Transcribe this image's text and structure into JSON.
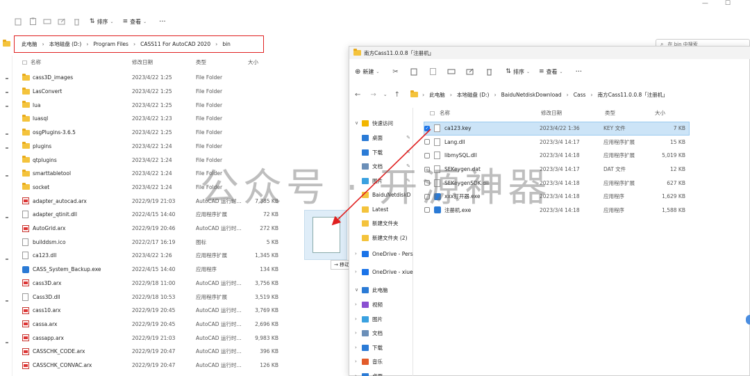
{
  "window_controls": [
    "—",
    "☐",
    "✕"
  ],
  "back": {
    "toolbar": {
      "sort": "排序",
      "view": "查看",
      "more": "···"
    },
    "breadcrumb": [
      "此电脑",
      "本地磁盘 (D:)",
      "Program Files",
      "CASS11 For AutoCAD 2020",
      "bin"
    ],
    "search_placeholder": "在 bin 中搜索",
    "headers": {
      "name": "名称",
      "date": "修改日期",
      "type": "类型",
      "size": "大小"
    },
    "rows": [
      {
        "name": "cass3D_images",
        "date": "2023/4/22 1:25",
        "type": "File Folder",
        "size": "",
        "icon": "folder"
      },
      {
        "name": "LasConvert",
        "date": "2023/4/22 1:25",
        "type": "File Folder",
        "size": "",
        "icon": "folder"
      },
      {
        "name": "lua",
        "date": "2023/4/22 1:25",
        "type": "File Folder",
        "size": "",
        "icon": "folder"
      },
      {
        "name": "luasql",
        "date": "2023/4/22 1:23",
        "type": "File Folder",
        "size": "",
        "icon": "folder"
      },
      {
        "name": "osgPlugins-3.6.5",
        "date": "2023/4/22 1:25",
        "type": "File Folder",
        "size": "",
        "icon": "folder"
      },
      {
        "name": "plugins",
        "date": "2023/4/22 1:24",
        "type": "File Folder",
        "size": "",
        "icon": "folder"
      },
      {
        "name": "qtplugins",
        "date": "2023/4/22 1:24",
        "type": "File Folder",
        "size": "",
        "icon": "folder"
      },
      {
        "name": "smarttabletool",
        "date": "2023/4/22 1:24",
        "type": "File Folder",
        "size": "",
        "icon": "folder"
      },
      {
        "name": "socket",
        "date": "2023/4/22 1:24",
        "type": "File Folder",
        "size": "",
        "icon": "folder"
      },
      {
        "name": "adapter_autocad.arx",
        "date": "2022/9/19 21:03",
        "type": "AutoCAD 运行时...",
        "size": "7,385 KB",
        "icon": "arx"
      },
      {
        "name": "adapter_qtinit.dll",
        "date": "2022/4/15 14:40",
        "type": "应用程序扩展",
        "size": "72 KB",
        "icon": "file"
      },
      {
        "name": "AutoGrid.arx",
        "date": "2022/9/19 20:46",
        "type": "AutoCAD 运行时...",
        "size": "272 KB",
        "icon": "arx"
      },
      {
        "name": "builddsm.ico",
        "date": "2022/2/17 16:19",
        "type": "图标",
        "size": "5 KB",
        "icon": "ico"
      },
      {
        "name": "ca123.dll",
        "date": "2023/4/22 1:26",
        "type": "应用程序扩展",
        "size": "1,345 KB",
        "icon": "file"
      },
      {
        "name": "CASS_System_Backup.exe",
        "date": "2022/4/15 14:40",
        "type": "应用程序",
        "size": "134 KB",
        "icon": "exe"
      },
      {
        "name": "cass3D.arx",
        "date": "2022/9/18 11:00",
        "type": "AutoCAD 运行时...",
        "size": "3,756 KB",
        "icon": "arx"
      },
      {
        "name": "Cass3D.dll",
        "date": "2022/9/18 10:53",
        "type": "应用程序扩展",
        "size": "3,519 KB",
        "icon": "file"
      },
      {
        "name": "cass10.arx",
        "date": "2022/9/19 20:45",
        "type": "AutoCAD 运行时...",
        "size": "3,769 KB",
        "icon": "arx"
      },
      {
        "name": "cassa.arx",
        "date": "2022/9/19 20:45",
        "type": "AutoCAD 运行时...",
        "size": "2,696 KB",
        "icon": "arx"
      },
      {
        "name": "cassapp.arx",
        "date": "2022/9/19 21:03",
        "type": "AutoCAD 运行时...",
        "size": "9,983 KB",
        "icon": "arx"
      },
      {
        "name": "CASSCHK_CODE.arx",
        "date": "2022/9/19 20:47",
        "type": "AutoCAD 运行时...",
        "size": "396 KB",
        "icon": "arx"
      },
      {
        "name": "CASSCHK_CONVAC.arx",
        "date": "2022/9/19 20:47",
        "type": "AutoCAD 运行时...",
        "size": "126 KB",
        "icon": "arx"
      }
    ]
  },
  "front": {
    "title": "南方Cass11.0.0.8「注册机」",
    "toolbar": {
      "new": "新建",
      "sort": "排序",
      "view": "查看",
      "more": "···"
    },
    "breadcrumb": [
      "此电脑",
      "本地磁盘 (D:)",
      "BaiduNetdiskDownload",
      "Cass",
      "南方Cass11.0.0.8「注册机」"
    ],
    "headers": {
      "name": "名称",
      "date": "修改日期",
      "type": "类型",
      "size": "大小"
    },
    "nav": [
      {
        "label": "快速访问",
        "chev": "∨",
        "color": "#f2b600",
        "pin": false
      },
      {
        "label": "桌面",
        "chev": "",
        "color": "#2b7bd6",
        "pin": true
      },
      {
        "label": "下载",
        "chev": "",
        "color": "#2b7bd6",
        "pin": true
      },
      {
        "label": "文档",
        "chev": "",
        "color": "#6b8fb8",
        "pin": true
      },
      {
        "label": "图片",
        "chev": "",
        "color": "#3aa1e0",
        "pin": true
      },
      {
        "label": "BaiduNetdiskD",
        "chev": "",
        "color": "#f4c33c",
        "pin": false
      },
      {
        "label": "Latest",
        "chev": "",
        "color": "#f4c33c",
        "pin": false
      },
      {
        "label": "新建文件夹",
        "chev": "",
        "color": "#f4c33c",
        "pin": false
      },
      {
        "label": "新建文件夹 (2)",
        "chev": "",
        "color": "#f4c33c",
        "pin": false
      },
      {
        "label": "OneDrive - Pers",
        "chev": "›",
        "color": "#1a73e8",
        "pin": false
      },
      {
        "label": "OneDrive - xiue",
        "chev": "›",
        "color": "#1a73e8",
        "pin": false
      },
      {
        "label": "此电脑",
        "chev": "∨",
        "color": "#2b7bd6",
        "pin": false
      },
      {
        "label": "视频",
        "chev": "›",
        "color": "#8a4fd1",
        "pin": false
      },
      {
        "label": "图片",
        "chev": "›",
        "color": "#3aa1e0",
        "pin": false
      },
      {
        "label": "文档",
        "chev": "›",
        "color": "#6b8fb8",
        "pin": false
      },
      {
        "label": "下载",
        "chev": "›",
        "color": "#2b7bd6",
        "pin": false
      },
      {
        "label": "音乐",
        "chev": "›",
        "color": "#e25b2a",
        "pin": false
      },
      {
        "label": "桌面",
        "chev": "›",
        "color": "#2b7bd6",
        "pin": false
      }
    ],
    "rows": [
      {
        "name": "ca123.key",
        "date": "2023/4/22 1:36",
        "type": "KEY 文件",
        "size": "7 KB",
        "selected": true
      },
      {
        "name": "Lang.dll",
        "date": "2023/3/4 14:17",
        "type": "应用程序扩展",
        "size": "15 KB",
        "selected": false
      },
      {
        "name": "libmySQL.dll",
        "date": "2023/3/4 14:18",
        "type": "应用程序扩展",
        "size": "5,019 KB",
        "selected": false
      },
      {
        "name": "SEKeygen.dat",
        "date": "2023/3/4 14:17",
        "type": "DAT 文件",
        "size": "12 KB",
        "selected": false
      },
      {
        "name": "SEKeygenSDK.dll",
        "date": "2023/3/4 14:18",
        "type": "应用程序扩展",
        "size": "627 KB",
        "selected": false
      },
      {
        "name": "xxx打开器.exe",
        "date": "2023/3/4 14:18",
        "type": "应用程序",
        "size": "1,629 KB",
        "selected": false
      },
      {
        "name": "注册机.exe",
        "date": "2023/3/4 14:18",
        "type": "应用程序",
        "size": "1,588 KB",
        "selected": false
      }
    ]
  },
  "drag": {
    "tooltip": "→ 移动到 bin"
  },
  "watermark": "公众号 · 开源神器",
  "colors": {
    "highlight_box": "#e02020",
    "selection": "#cce4f7",
    "arrow": "#e02020"
  }
}
